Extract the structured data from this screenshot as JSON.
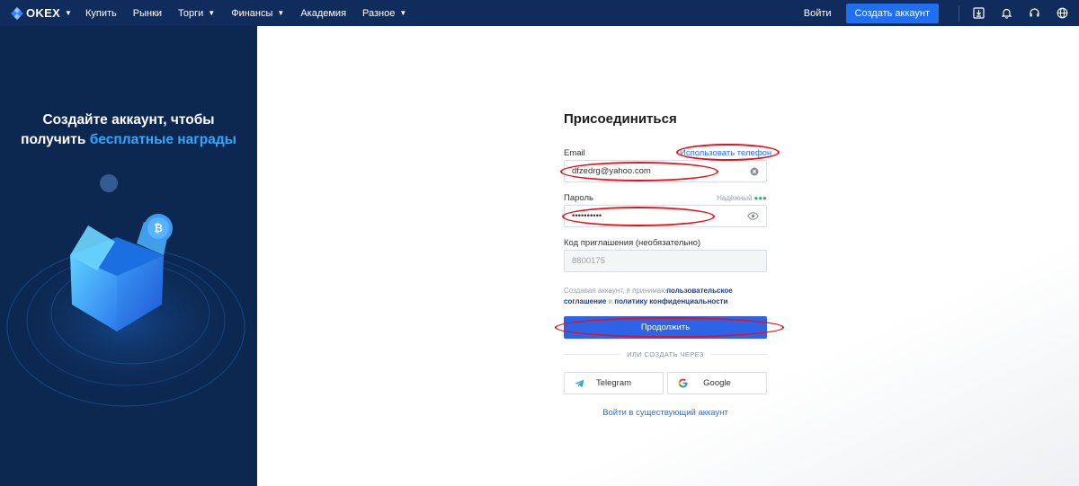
{
  "header": {
    "logo_text": "OKEX",
    "nav": [
      {
        "label": "Купить",
        "has_menu": false
      },
      {
        "label": "Рынки",
        "has_menu": false
      },
      {
        "label": "Торги",
        "has_menu": true
      },
      {
        "label": "Финансы",
        "has_menu": true
      },
      {
        "label": "Академия",
        "has_menu": false
      },
      {
        "label": "Разное",
        "has_menu": true
      }
    ],
    "login_label": "Войти",
    "create_account_label": "Создать аккаунт",
    "icons": [
      "download-icon",
      "bell-icon",
      "headset-icon",
      "globe-icon"
    ]
  },
  "promo": {
    "line1": "Создайте аккаунт, чтобы",
    "line2_prefix": "получить ",
    "line2_highlight": "бесплатные награды"
  },
  "form": {
    "title": "Присоединиться",
    "email_label": "Email",
    "use_phone_link": "Использовать телефон",
    "email_value": "dfzedrg@yahoo.com",
    "password_label": "Пароль",
    "password_strength": "Надёжный",
    "password_value": "••••••••••",
    "invite_label": "Код приглашения (необязательно)",
    "invite_value": "8800175",
    "terms_prefix": "Создавая аккаунт, я принимаю",
    "terms_link1": "пользовательское соглашение",
    "terms_and": " и ",
    "terms_link2": "политику конфиденциальности",
    "continue_label": "Продолжить",
    "or_label": "ИЛИ СОЗДАТЬ ЧЕРЕЗ",
    "telegram_label": "Telegram",
    "google_label": "Google",
    "existing_account_link": "Войти в существующий аккаунт"
  },
  "colors": {
    "topbar": "#0f2c5c",
    "left_panel": "#0c2750",
    "primary": "#2d63e6",
    "link": "#2670e8",
    "annotation": "#e0141e"
  }
}
